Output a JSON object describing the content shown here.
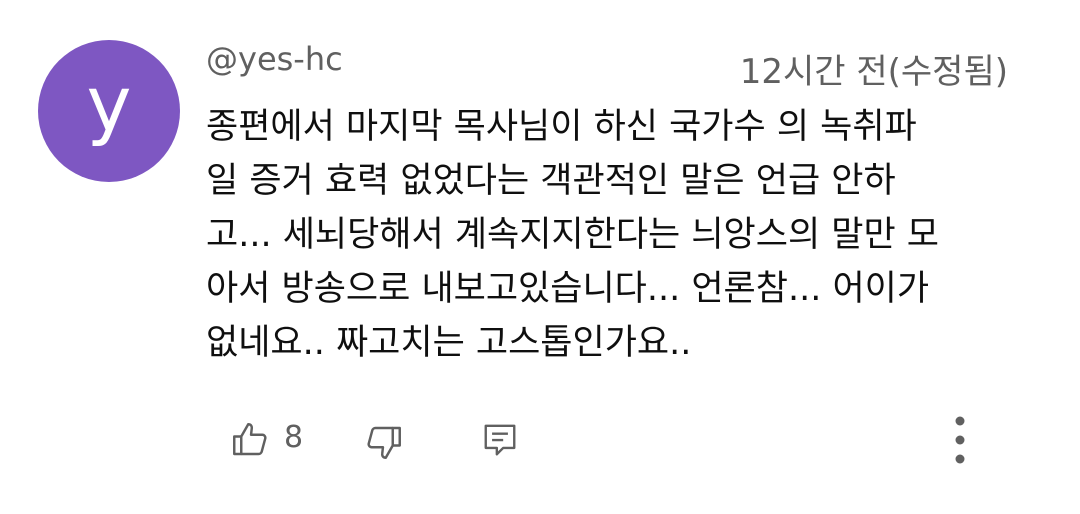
{
  "comment": {
    "avatar_letter": "y",
    "avatar_color": "#7e57c2",
    "author": "@yes-hc",
    "timestamp": "12시간 전(수정됨)",
    "text": "종편에서 마지막 목사님이 하신 국가수 의 녹취파\n일 증거 효력 없었다는 객관적인 말은 언급 안하\n고... 세뇌당해서 계속지지한다는 늬앙스의 말만 모\n아서 방송으로 내보고있습니다... 언론참... 어이가\n없네요.. 짜고치는 고스톱인가요..",
    "like_count": "8"
  },
  "icons": {
    "like": "thumbs-up-icon",
    "dislike": "thumbs-down-icon",
    "reply": "comment-reply-icon",
    "more": "more-vertical-icon"
  }
}
